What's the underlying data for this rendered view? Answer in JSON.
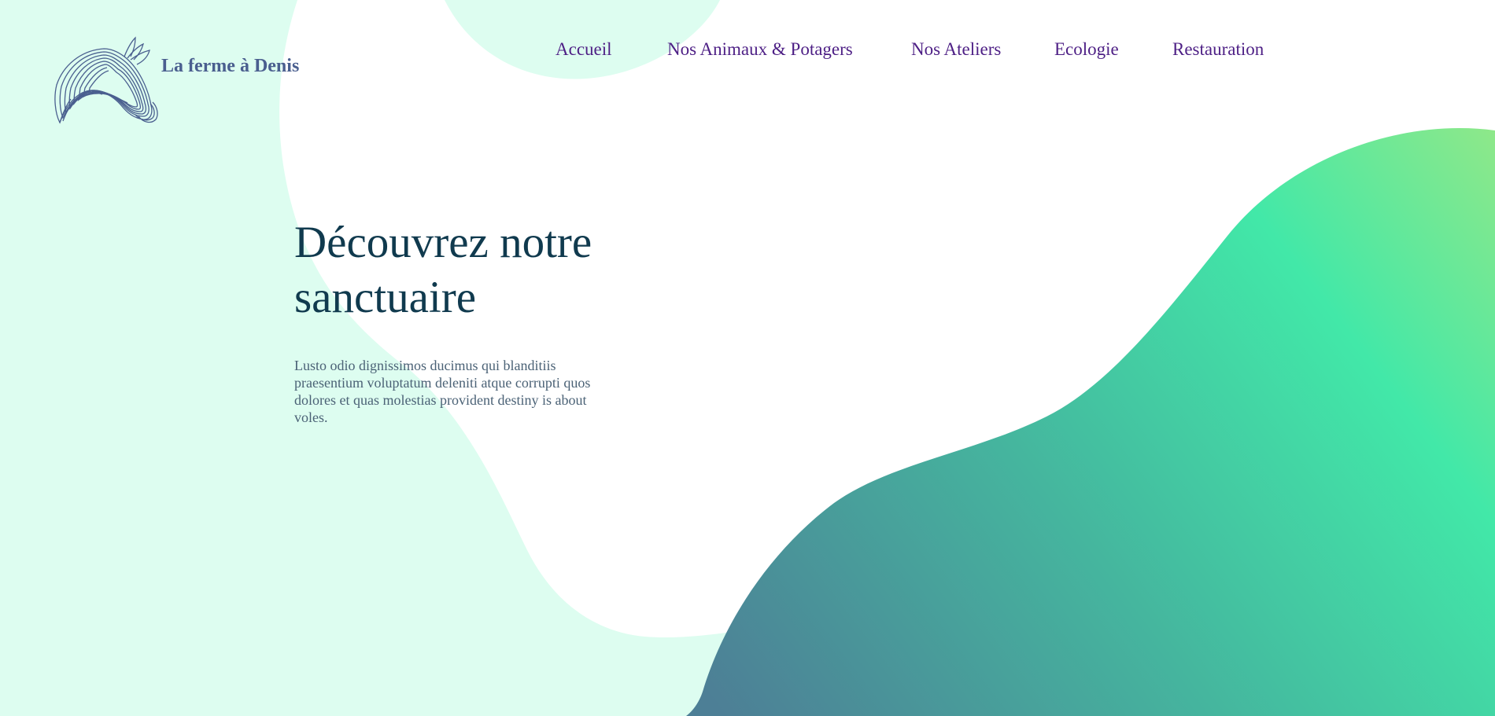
{
  "brand": {
    "name": "La ferme à Denis"
  },
  "nav": {
    "items": [
      {
        "label": "Accueil"
      },
      {
        "label": "Nos Animaux & Potagers"
      },
      {
        "label": "Nos Ateliers"
      },
      {
        "label": "Ecologie"
      },
      {
        "label": "Restauration"
      }
    ]
  },
  "hero": {
    "title": "Découvrez notre sanctuaire",
    "text": "Lusto odio dignissimos ducimus qui blanditiis praesentium voluptatum deleniti atque corrupti quos dolores et quas molestias provident destiny is about voles."
  },
  "colors": {
    "mint_background": "#ddfdf0",
    "brand_text": "#4a5f8f",
    "nav_text": "#4d1f85",
    "title_text": "#103a4e",
    "gradient_top": "#8fe889",
    "gradient_mid": "#42e8a8",
    "gradient_bottom": "#4d7f96"
  },
  "icons": {
    "logo": "horse-head-logo-icon"
  }
}
